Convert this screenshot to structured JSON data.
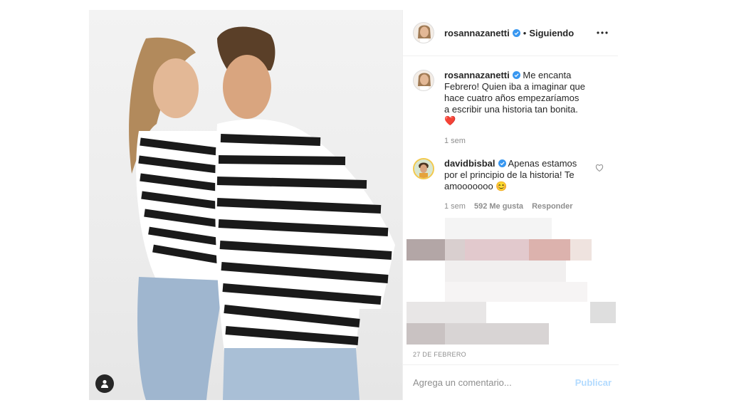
{
  "post": {
    "author": "rosannazanetti",
    "follow_state": "Siguiendo",
    "separator": "•",
    "date": "27 DE FEBRERO"
  },
  "comments": [
    {
      "user": "rosannazanetti",
      "text": "Me encanta Febrero! Quien iba a imaginar que hace cuatro años empezaríamos a escribir una historia tan bonita.",
      "emoji": "❤️",
      "time": "1 sem"
    },
    {
      "user": "davidbisbal",
      "text": "Apenas estamos por el principio de la historia! Te amooooooo",
      "emoji": "😊",
      "time": "1 sem",
      "likes": "592 Me gusta",
      "reply_label": "Responder"
    }
  ],
  "input": {
    "placeholder": "Agrega un comentario...",
    "publish_label": "Publicar"
  },
  "icons": {
    "verified": "verified-badge-icon",
    "more": "more-options-icon",
    "like": "heart-icon",
    "tag": "user-tag-icon"
  },
  "colors": {
    "verified_blue": "#3897f0",
    "publish_disabled": "#b3dbff",
    "heart_red": "#d0021b"
  }
}
